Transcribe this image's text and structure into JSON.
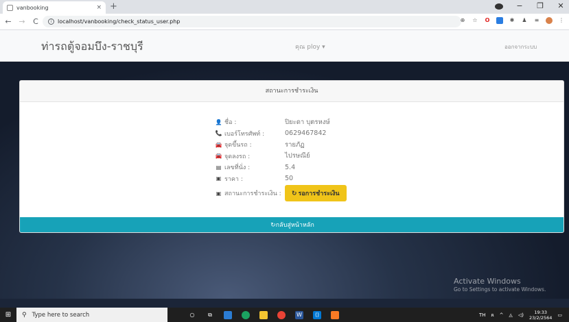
{
  "browser": {
    "tab_title": "vanbooking",
    "tab_close": "×",
    "new_tab": "+",
    "url": "localhost/vanbooking/check_status_user.php"
  },
  "navbar": {
    "brand": "ท่ารถตู้จอมบึง-ราชบุรี",
    "user": "คุณ ploy ▾",
    "logout": "ออกจากระบบ"
  },
  "card": {
    "header": "สถานะการชำระเงิน",
    "rows": [
      {
        "icon": "user-icon",
        "glyph": "👤",
        "label": "ชื่อ :",
        "value": "ปิยะดา บุตรหงษ์"
      },
      {
        "icon": "phone-icon",
        "glyph": "📞",
        "label": "เบอร์โทรศัพท์ :",
        "value": "0629467842"
      },
      {
        "icon": "car-icon",
        "glyph": "🚘",
        "label": "จุดขึ้นรถ :",
        "value": "รายภัฏ"
      },
      {
        "icon": "car-icon",
        "glyph": "🚘",
        "label": "จุดลงรถ :",
        "value": "ไปรษณีย์"
      },
      {
        "icon": "seat-card-icon",
        "glyph": "▤",
        "label": "เลขที่นั่ง :",
        "value": "5.4"
      },
      {
        "icon": "money-icon",
        "glyph": "▣",
        "label": "ราคา :",
        "value": "50"
      }
    ],
    "status_label": "สถานะการชำระเงิน :",
    "status_value": "รอการชำระเงิน",
    "back_button": "กลับสู่หน้าหลัก"
  },
  "watermark": {
    "title": "Activate Windows",
    "subtitle": "Go to Settings to activate Windows."
  },
  "taskbar": {
    "search_placeholder": "Type here to search",
    "lang": "TH",
    "time": "19:33",
    "date": "23/2/2564"
  },
  "colors": {
    "accent": "#17a2b8",
    "warning": "#f0c419"
  }
}
